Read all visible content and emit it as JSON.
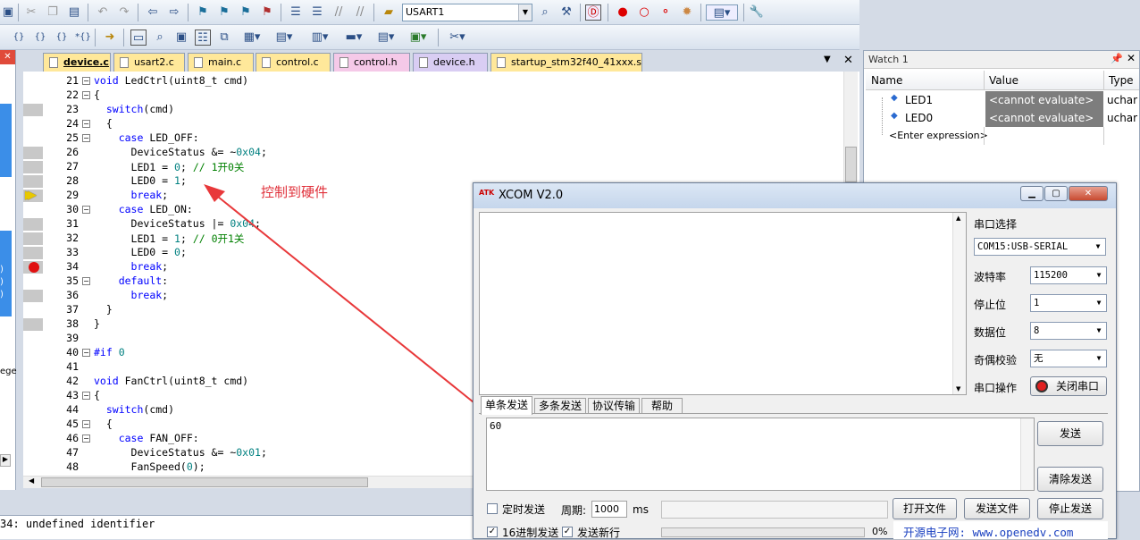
{
  "toolbar": {
    "target_combo": "USART1"
  },
  "tabs": [
    {
      "label": "device.c",
      "bg": "#ffe89a",
      "active": true
    },
    {
      "label": "usart2.c",
      "bg": "#ffe89a"
    },
    {
      "label": "main.c",
      "bg": "#ffe89a"
    },
    {
      "label": "control.c",
      "bg": "#ffe89a"
    },
    {
      "label": "control.h",
      "bg": "#f5c9e8"
    },
    {
      "label": "device.h",
      "bg": "#d9cdf3"
    },
    {
      "label": "startup_stm32f40_41xxx.s",
      "bg": "#ffe89a"
    }
  ],
  "editor": {
    "annotation": "控制到硬件",
    "lines": [
      {
        "n": "21",
        "fold": "-",
        "t": "void LedCtrl(uint8_t cmd)"
      },
      {
        "n": "22",
        "fold": "-",
        "t": "{"
      },
      {
        "n": "23",
        "t": "  switch(cmd)"
      },
      {
        "n": "24",
        "fold": "-",
        "t": "  {"
      },
      {
        "n": "25",
        "fold": "-",
        "t": "    case LED_OFF:"
      },
      {
        "n": "26",
        "t": "      DeviceStatus &= ~0x04;"
      },
      {
        "n": "27",
        "t": "      LED1 = 0; // 1开0关"
      },
      {
        "n": "28",
        "t": "      LED0 = 1;"
      },
      {
        "n": "29",
        "t": "      break;"
      },
      {
        "n": "30",
        "fold": "-",
        "t": "    case LED_ON:"
      },
      {
        "n": "31",
        "t": "      DeviceStatus |= 0x04;"
      },
      {
        "n": "32",
        "t": "      LED1 = 1; // 0开1关"
      },
      {
        "n": "33",
        "t": "      LED0 = 0;"
      },
      {
        "n": "34",
        "t": "      break;"
      },
      {
        "n": "35",
        "fold": "-",
        "t": "    default:"
      },
      {
        "n": "36",
        "t": "      break;"
      },
      {
        "n": "37",
        "t": "  }"
      },
      {
        "n": "38",
        "t": "}"
      },
      {
        "n": "39",
        "t": ""
      },
      {
        "n": "40",
        "fold": "-",
        "t": "#if 0"
      },
      {
        "n": "41",
        "t": ""
      },
      {
        "n": "42",
        "t": "void FanCtrl(uint8_t cmd)"
      },
      {
        "n": "43",
        "fold": "-",
        "t": "{"
      },
      {
        "n": "44",
        "t": "  switch(cmd)"
      },
      {
        "n": "45",
        "fold": "-",
        "t": "  {"
      },
      {
        "n": "46",
        "fold": "-",
        "t": "    case FAN_OFF:"
      },
      {
        "n": "47",
        "t": "      DeviceStatus &= ~0x01;"
      },
      {
        "n": "48",
        "t": "      FanSpeed(0);"
      }
    ]
  },
  "watch": {
    "title": "Watch 1",
    "cols": [
      "Name",
      "Value",
      "Type"
    ],
    "rows": [
      {
        "name": "LED1",
        "value": "<cannot evaluate>",
        "type": "uchar"
      },
      {
        "name": "LED0",
        "value": "<cannot evaluate>",
        "type": "uchar"
      }
    ],
    "enter": "<Enter expression>"
  },
  "left_partial": [
    ")",
    ")",
    ")",
    ":)",
    "ege"
  ],
  "status": {
    "message": "34: undefined identifier"
  },
  "xcom": {
    "title": "XCOM V2.0",
    "logo": "ATK",
    "port_label": "串口选择",
    "port_value": "COM15:USB-SERIAL",
    "baud_label": "波特率",
    "baud_value": "115200",
    "stop_label": "停止位",
    "stop_value": "1",
    "data_label": "数据位",
    "data_value": "8",
    "parity_label": "奇偶校验",
    "parity_value": "无",
    "op_label": "串口操作",
    "close_port": "关闭串口",
    "tabs": [
      "单条发送",
      "多条发送",
      "协议传输",
      "帮助"
    ],
    "send_text": "60",
    "send_btn": "发送",
    "clear_btn": "清除发送",
    "timed_send": "定时发送",
    "period_label": "周期:",
    "period_value": "1000",
    "ms": "ms",
    "open_file": "打开文件",
    "send_file": "发送文件",
    "stop_send": "停止发送",
    "hex_send": "16进制发送",
    "newline": "发送新行",
    "progress": "0%",
    "site": "开源电子网: www.openedv.com"
  }
}
